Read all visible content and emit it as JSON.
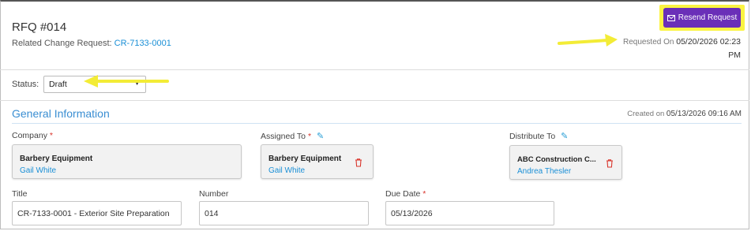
{
  "header": {
    "title": "RFQ #014",
    "related_label": "Related Change Request:",
    "related_link": "CR-7133-0001",
    "resend_label": "Resend Request",
    "requested_label": "Requested On",
    "requested_value": "05/20/2026 02:23 PM"
  },
  "status": {
    "label": "Status:",
    "value": "Draft"
  },
  "general": {
    "title": "General Information",
    "created_label": "Created on",
    "created_value": "05/13/2026 09:16 AM"
  },
  "company": {
    "label": "Company",
    "required": "*",
    "name": "Barbery Equipment",
    "person": "Gail White"
  },
  "assigned": {
    "label": "Assigned To",
    "required": "*",
    "name": "Barbery Equipment",
    "person": "Gail White"
  },
  "distribute": {
    "label": "Distribute To",
    "name": "ABC Construction C...",
    "person": "Andrea Thesler"
  },
  "fields": {
    "title_label": "Title",
    "title_value": "CR-7133-0001 - Exterior Site Preparation",
    "number_label": "Number",
    "number_value": "014",
    "due_label": "Due Date",
    "due_required": "*",
    "due_value": "05/13/2026"
  },
  "colors": {
    "accent": "#3a8ed2",
    "button": "#6a2fb8",
    "highlight": "#fbf442",
    "link": "#1a8fd6"
  }
}
